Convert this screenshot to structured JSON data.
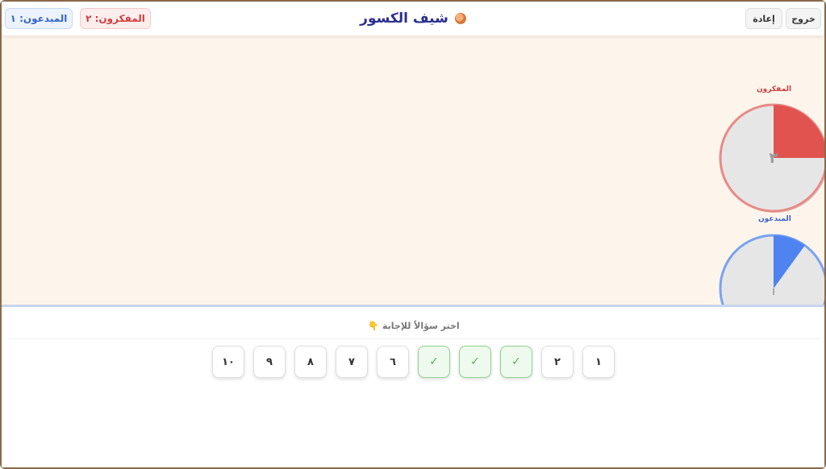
{
  "header": {
    "exit_label": "خروج",
    "reset_label": "إعادة",
    "title": "شيف الكسور",
    "title_icon": "pizza-icon",
    "score_thinkers": "المفكرون: ٢",
    "score_creators": "المبدعون: ١"
  },
  "board": {
    "teams": [
      {
        "name": "المفكرون",
        "color": "#e0534f",
        "ring": "#e88a86",
        "fraction": 0.25,
        "center_label": "٣"
      },
      {
        "name": "المبدعون",
        "color": "#4f83f0",
        "ring": "#7aa2f0",
        "fraction": 0.1
      }
    ]
  },
  "panel": {
    "prompt": "اختر سؤالاً للإجابة",
    "prompt_icon": "👇",
    "questions": [
      {
        "label": "١",
        "state": "open"
      },
      {
        "label": "٢",
        "state": "open"
      },
      {
        "label": "✓",
        "state": "done"
      },
      {
        "label": "✓",
        "state": "done"
      },
      {
        "label": "✓",
        "state": "done"
      },
      {
        "label": "٦",
        "state": "open"
      },
      {
        "label": "٧",
        "state": "open"
      },
      {
        "label": "٨",
        "state": "open"
      },
      {
        "label": "٩",
        "state": "open"
      },
      {
        "label": "١٠",
        "state": "open"
      }
    ]
  }
}
